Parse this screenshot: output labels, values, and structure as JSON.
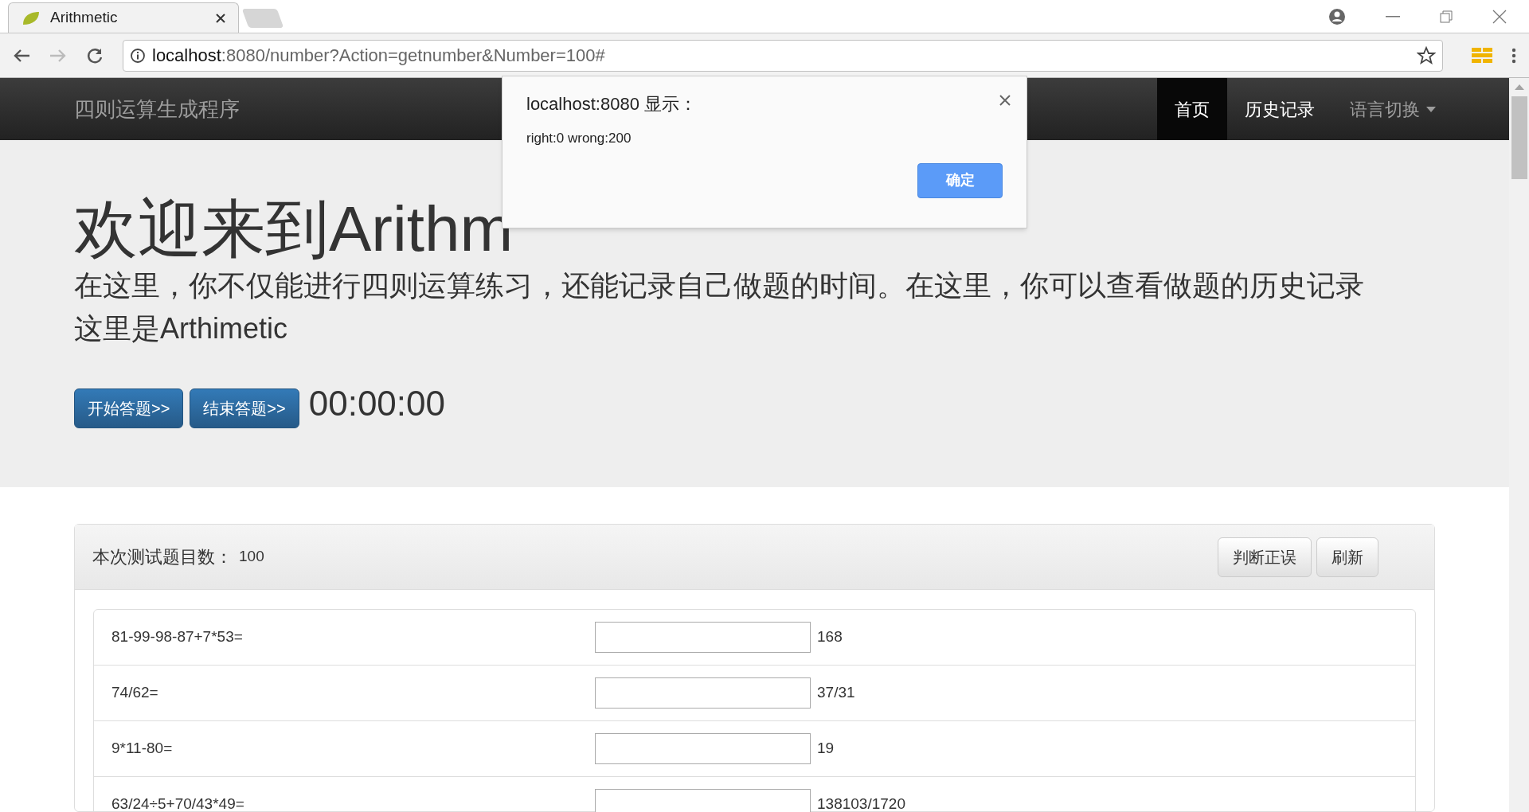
{
  "browser": {
    "tab_title": "Arithmetic",
    "url_host": "localhost",
    "url_rest": ":8080/number?Action=getnumber&Number=100#"
  },
  "navbar": {
    "brand": "四则运算生成程序",
    "items": [
      {
        "label": "首页",
        "selected": true,
        "dropdown": false
      },
      {
        "label": "历史记录",
        "selected": false,
        "dropdown": false
      },
      {
        "label": "语言切换",
        "selected": false,
        "dropdown": true
      }
    ]
  },
  "hero": {
    "title": "欢迎来到Arithm",
    "lines": [
      "在这里，你不仅能进行四则运算练习，还能记录自己做题的时间。在这里，你可以查看做题的历史记录",
      "这里是Arthimetic"
    ],
    "buttons": [
      "开始答题>>",
      "结束答题>>"
    ],
    "timer": "00:00:00"
  },
  "panel": {
    "label": "本次测试题目数：",
    "count": "100",
    "buttons": [
      "判断正误",
      "刷新"
    ],
    "rows": [
      {
        "question": "81-99-98-87+7*53=",
        "answer": "168"
      },
      {
        "question": "74/62=",
        "answer": "37/31"
      },
      {
        "question": "9*11-80=",
        "answer": "19"
      },
      {
        "question": "63/24÷5+70/43*49=",
        "answer": "138103/1720"
      }
    ]
  },
  "dialog": {
    "title": "localhost:8080 显示：",
    "message": "right:0 wrong:200",
    "button": "确定"
  }
}
